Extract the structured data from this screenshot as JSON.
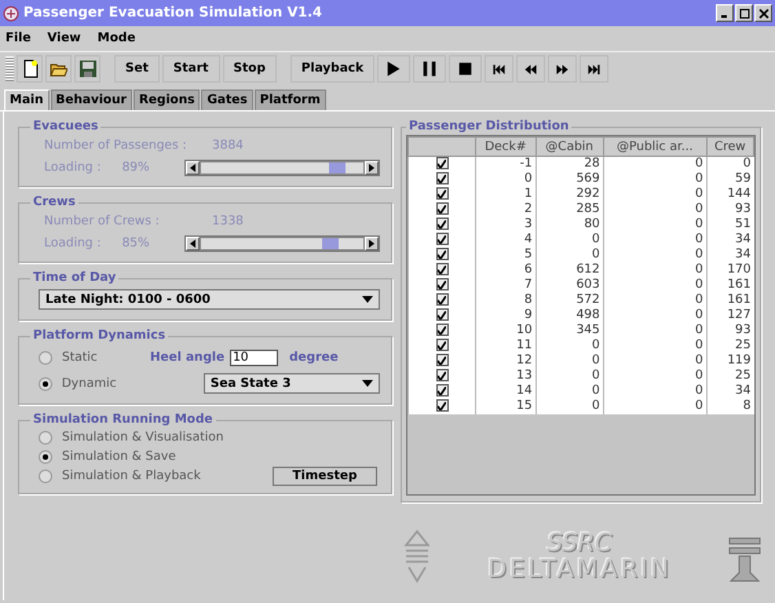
{
  "window": {
    "title": "Passenger Evacuation Simulation V1.4"
  },
  "menu": [
    "File",
    "View",
    "Mode"
  ],
  "toolbar": {
    "file_buttons": [
      {
        "kind": "new"
      },
      {
        "kind": "open"
      },
      {
        "kind": "save"
      }
    ],
    "buttons": [
      "Set",
      "Start",
      "Stop",
      "Playback"
    ],
    "media_buttons": [
      {
        "kind": "play"
      },
      {
        "kind": "pause"
      },
      {
        "kind": "stop"
      },
      {
        "kind": "first"
      },
      {
        "kind": "back"
      },
      {
        "kind": "forward"
      },
      {
        "kind": "last"
      }
    ]
  },
  "tabs": [
    {
      "label": "Main",
      "selected": true
    },
    {
      "label": "Behaviour",
      "selected": false
    },
    {
      "label": "Regions",
      "selected": false
    },
    {
      "label": "Gates",
      "selected": false
    },
    {
      "label": "Platform",
      "selected": false
    }
  ],
  "evacuees": {
    "title": "Evacuees",
    "count_label": "Number of Passenges :",
    "count": "3884",
    "loading_label": "Loading :",
    "loading": "89%",
    "level": 0.89
  },
  "crews": {
    "title": "Crews",
    "count_label": "Number of Crews :",
    "count": "1338",
    "loading_label": "Loading :",
    "loading": "85%",
    "level": 0.85
  },
  "time_of_day": {
    "title": "Time of Day",
    "value": "Late Night: 0100 - 0600"
  },
  "platform_dynamics": {
    "title": "Platform Dynamics",
    "options": [
      {
        "label": "Static",
        "selected": false
      },
      {
        "label": "Dynamic",
        "selected": true
      }
    ],
    "heel_label": "Heel angle",
    "heel_value": "10",
    "heel_unit": "degree",
    "sea_state": "Sea State 3"
  },
  "running_mode": {
    "title": "Simulation Running Mode",
    "options": [
      {
        "label": "Simulation & Visualisation",
        "selected": false
      },
      {
        "label": "Simulation & Save",
        "selected": true
      },
      {
        "label": "Simulation & Playback",
        "selected": false
      }
    ],
    "button": "Timestep"
  },
  "distribution": {
    "title": "Passenger Distribution",
    "columns": [
      "Deck#",
      "@Cabin",
      "@Public ar...",
      "Crew"
    ],
    "rows": [
      {
        "checked": true,
        "cells": [
          "-1",
          "28",
          "0",
          "0"
        ]
      },
      {
        "checked": true,
        "cells": [
          "0",
          "569",
          "0",
          "59"
        ]
      },
      {
        "checked": true,
        "cells": [
          "1",
          "292",
          "0",
          "144"
        ]
      },
      {
        "checked": true,
        "cells": [
          "2",
          "285",
          "0",
          "93"
        ]
      },
      {
        "checked": true,
        "cells": [
          "3",
          "80",
          "0",
          "51"
        ]
      },
      {
        "checked": true,
        "cells": [
          "4",
          "0",
          "0",
          "34"
        ]
      },
      {
        "checked": true,
        "cells": [
          "5",
          "0",
          "0",
          "34"
        ]
      },
      {
        "checked": true,
        "cells": [
          "6",
          "612",
          "0",
          "170"
        ]
      },
      {
        "checked": true,
        "cells": [
          "7",
          "603",
          "0",
          "161"
        ]
      },
      {
        "checked": true,
        "cells": [
          "8",
          "572",
          "0",
          "161"
        ]
      },
      {
        "checked": true,
        "cells": [
          "9",
          "498",
          "0",
          "127"
        ]
      },
      {
        "checked": true,
        "cells": [
          "10",
          "345",
          "0",
          "93"
        ]
      },
      {
        "checked": true,
        "cells": [
          "11",
          "0",
          "0",
          "25"
        ]
      },
      {
        "checked": true,
        "cells": [
          "12",
          "0",
          "0",
          "119"
        ]
      },
      {
        "checked": true,
        "cells": [
          "13",
          "0",
          "0",
          "25"
        ]
      },
      {
        "checked": true,
        "cells": [
          "14",
          "0",
          "0",
          "34"
        ]
      },
      {
        "checked": true,
        "cells": [
          "15",
          "0",
          "0",
          "8"
        ]
      }
    ]
  },
  "logo": {
    "line1": "SSRC",
    "line2": "DELTAMARIN"
  }
}
